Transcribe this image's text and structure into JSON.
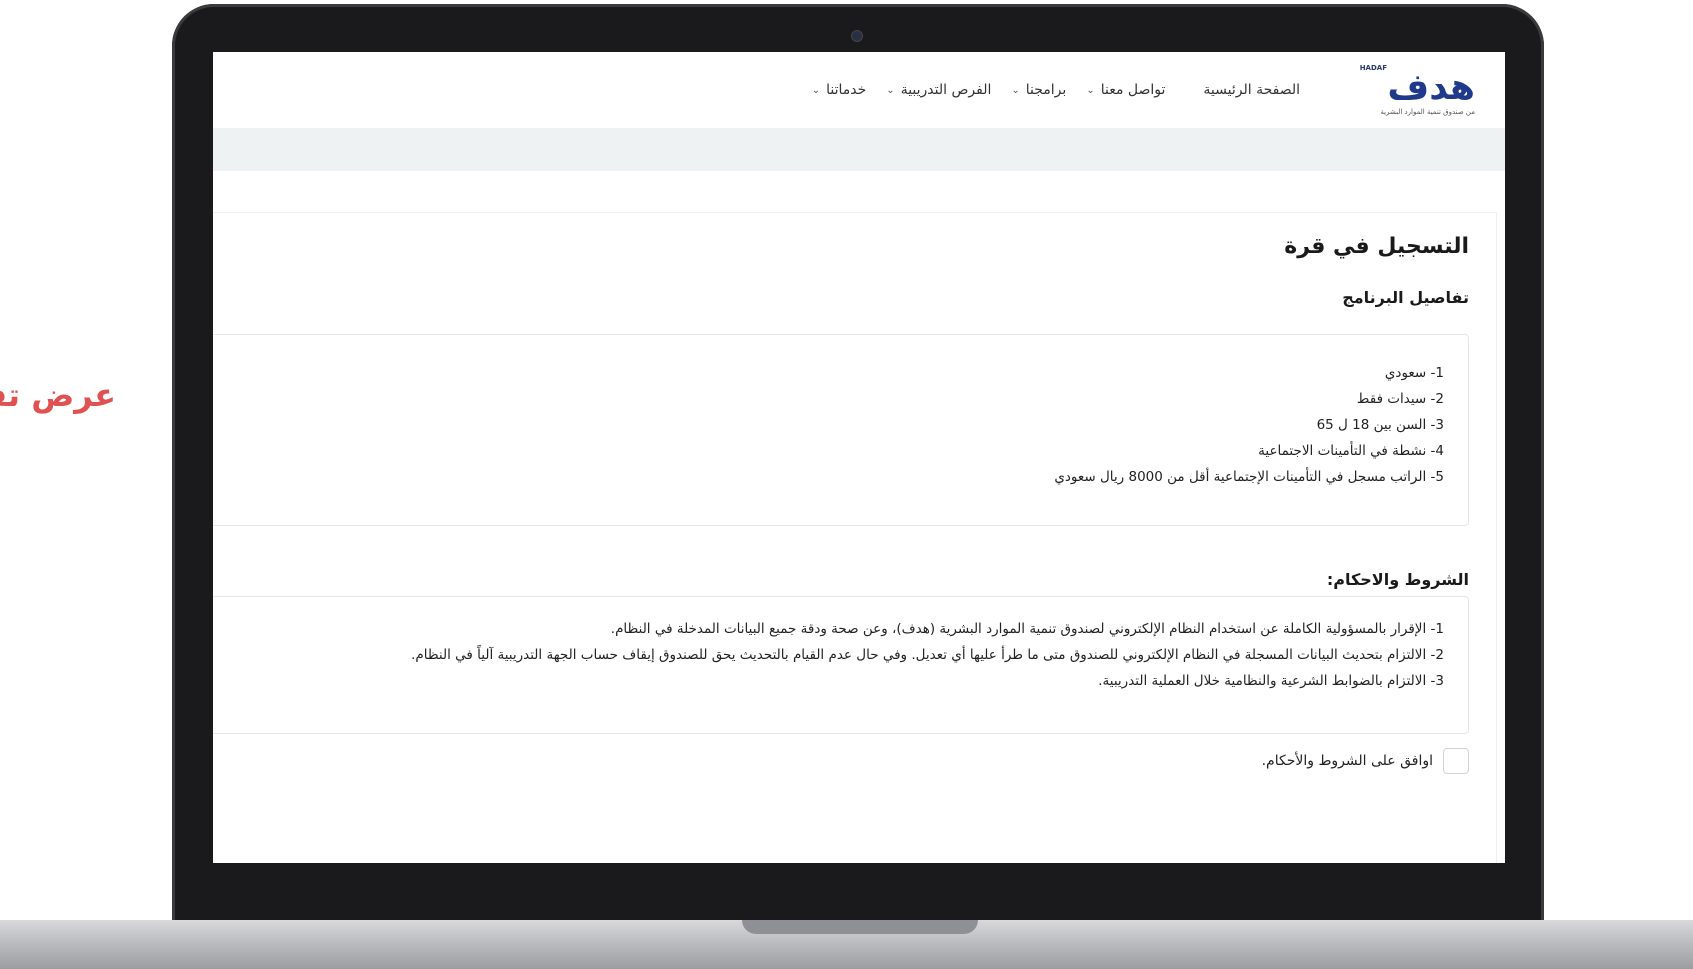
{
  "side_caption": "عرض تفاصيل البرنامج",
  "logo": {
    "small": "HADAF",
    "main": "هدف",
    "tagline": "من صندوق تنمية الموارد البشرية"
  },
  "nav": {
    "home": "الصفحة الرئيسية",
    "contact": "تواصل معنا",
    "programs": "برامجنا",
    "training": "الفرص التدريبية",
    "services": "خدماتنا"
  },
  "page": {
    "title": "التسجيل في قرة",
    "details_heading": "تفاصيل البرنامج",
    "details": [
      "1- سعودي",
      "2- سيدات فقط",
      "3- السن بين 18 ل 65",
      "4- نشطة في التأمينات الاجتماعية",
      "5- الراتب مسجل في التأمينات الإجتماعية أقل من 8000 ريال سعودي"
    ],
    "terms_heading": "الشروط والاحكام:",
    "terms": [
      "1-   الإقرار بالمسؤولية الكاملة عن استخدام النظام الإلكتروني لصندوق تنمية الموارد البشرية (هدف)، وعن صحة ودقة جميع البيانات المدخلة في النظام.",
      "2-   الالتزام بتحديث البيانات المسجلة في النظام الإلكتروني للصندوق متى ما طرأ عليها أي تعديل. وفي حال عدم القيام بالتحديث يحق للصندوق إيقاف حساب الجهة التدريبية آلياً في النظام.",
      "3-   الالتزام بالضوابط الشرعية والنظامية خلال العملية التدريبية."
    ],
    "agree_label": "اوافق على الشروط والأحكام."
  },
  "colors": {
    "caption": "#e05252",
    "brand_navy": "#1f3a8a",
    "brand_teal": "#1e9fb0",
    "band": "#eef2f3"
  }
}
